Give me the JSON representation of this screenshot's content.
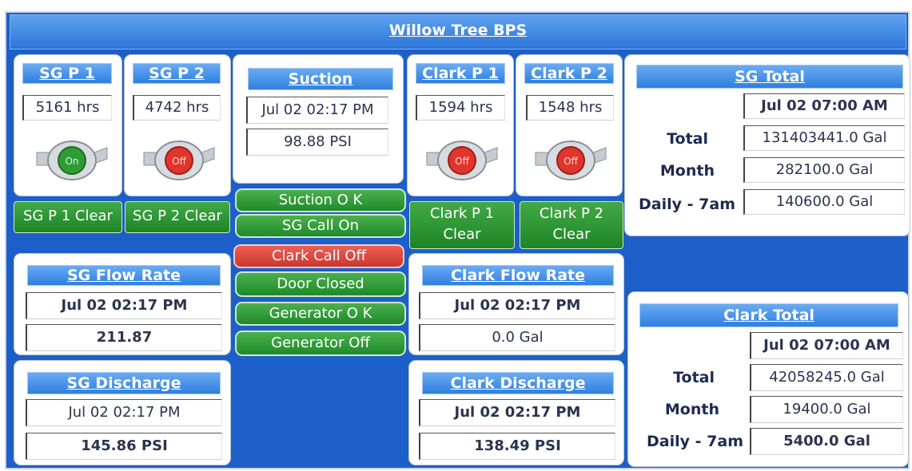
{
  "header": {
    "title": "Willow Tree BPS"
  },
  "pumps": {
    "sgp1": {
      "title": "SG P 1",
      "hours": "5161 hrs",
      "state": "On",
      "alarm": "SG P 1 Clear"
    },
    "sgp2": {
      "title": "SG P 2",
      "hours": "4742 hrs",
      "state": "Off",
      "alarm": "SG P 2 Clear"
    },
    "clarkp1": {
      "title": "Clark P 1",
      "hours": "1594 hrs",
      "state": "Off",
      "alarm_line1": "Clark P 1",
      "alarm_line2": "Clear"
    },
    "clarkp2": {
      "title": "Clark P 2",
      "hours": "1548 hrs",
      "state": "Off",
      "alarm_line1": "Clark P 2",
      "alarm_line2": "Clear"
    }
  },
  "suction": {
    "title": "Suction",
    "timestamp": "Jul 02 02:17 PM",
    "value": "98.88 PSI"
  },
  "status_buttons": {
    "suction_ok": "Suction O K",
    "sg_call": "SG Call On",
    "clark_call": "Clark Call Off",
    "door": "Door Closed",
    "generator_ok": "Generator O K",
    "generator_state": "Generator Off"
  },
  "sg_flow": {
    "title": "SG Flow Rate",
    "timestamp": "Jul 02 02:17 PM",
    "value": "211.87"
  },
  "sg_discharge": {
    "title": "SG Discharge",
    "timestamp": "Jul 02 02:17 PM",
    "value": "145.86 PSI"
  },
  "clark_flow": {
    "title": "Clark Flow Rate",
    "timestamp": "Jul 02 02:17 PM",
    "value": "0.0 Gal"
  },
  "clark_discharge": {
    "title": "Clark Discharge",
    "timestamp": "Jul 02 02:17 PM",
    "value": "138.49 PSI"
  },
  "sg_total": {
    "title": "SG Total",
    "timestamp": "Jul 02 07:00 AM",
    "total_label": "Total",
    "total": "131403441.0 Gal",
    "month_label": "Month",
    "month": "282100.0 Gal",
    "daily_label": "Daily - 7am",
    "daily": "140600.0 Gal"
  },
  "clark_total": {
    "title": "Clark Total",
    "timestamp": "Jul 02 07:00 AM",
    "total_label": "Total",
    "total": "42058245.0 Gal",
    "month_label": "Month",
    "month": "19400.0 Gal",
    "daily_label": "Daily - 7am",
    "daily": "5400.0 Gal"
  },
  "colors": {
    "background": "#1d5fc8",
    "on": "#2e9b35",
    "off": "#e0352c",
    "accent": "#3a86e6"
  }
}
